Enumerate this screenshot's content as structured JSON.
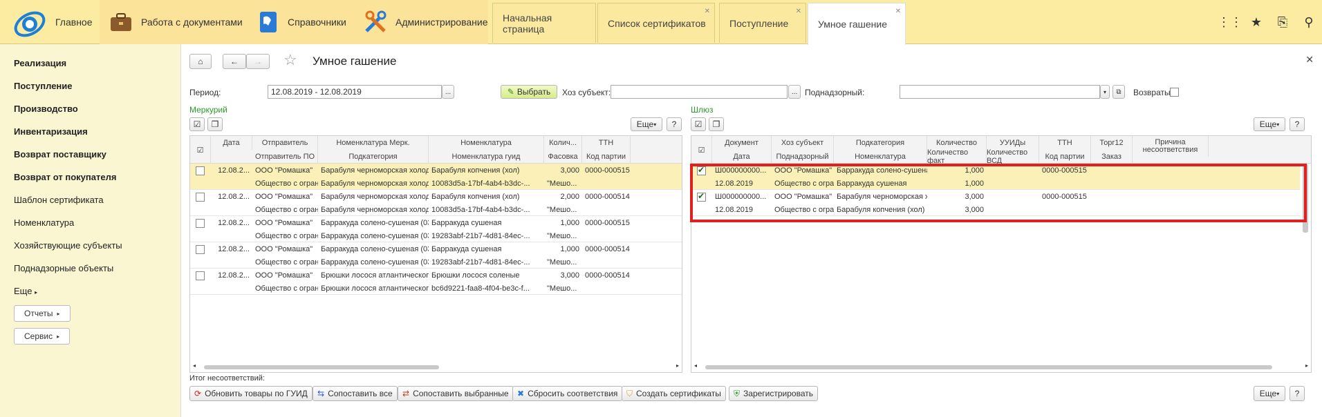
{
  "topbar": {
    "home_label": "Главное",
    "sections": [
      "Работа с документами",
      "Справочники",
      "Администрирование"
    ],
    "tabs": [
      {
        "label": "Начальная страница"
      },
      {
        "label": "Список сертификатов"
      },
      {
        "label": "Поступление"
      },
      {
        "label": "Умное гашение"
      }
    ]
  },
  "nav": {
    "bold_items": [
      "Реализация",
      "Поступление",
      "Производство",
      "Инвентаризация",
      "Возврат поставщику",
      "Возврат от покупателя"
    ],
    "items": [
      "Шаблон сертификата",
      "Номенклатура",
      "Хозяйствующие субъекты",
      "Поднадзорные объекты"
    ],
    "more": "Еще",
    "reports": "Отчеты",
    "service": "Сервис"
  },
  "form": {
    "title": "Умное гашение",
    "period_label": "Период:",
    "period_value": "12.08.2019 - 12.08.2019",
    "choose_button": "Выбрать",
    "hoz_label": "Хоз субъект:",
    "podnadz_label": "Поднадзорный:",
    "returns_label": "Возвраты:",
    "more_button": "Еще",
    "help_button": "?",
    "mismatch_label": "Итог несоответствий:"
  },
  "mercury": {
    "title": "Меркурий",
    "headers_top": [
      "Дата",
      "Отправитель",
      "Номенклатура Мерк.",
      "Номенклатура",
      "Колич...",
      "ТТН"
    ],
    "headers_bottom": [
      "Отправитель ПО",
      "Подкатегория",
      "Номенклатура гуид",
      "Фасовка",
      "Код партии"
    ],
    "rows": [
      {
        "date": "12.08.2...",
        "sender": "ООО \"Ромашка\"",
        "nom_merc": "Барабуля черноморская холодног...",
        "nom": "Барабуля копчения (хол)",
        "qty": "3,000",
        "ttn": "0000-000515",
        "sender_po": "Общество с огран...",
        "subcat": "Барабуля черноморская холодног...",
        "guid": "10083d5a-17bf-4ab4-b3dc-...",
        "pack": "\"Мешо..."
      },
      {
        "date": "12.08.2...",
        "sender": "ООО \"Ромашка\"",
        "nom_merc": "Барабуля черноморская холодног...",
        "nom": "Барабуля копчения (хол)",
        "qty": "2,000",
        "ttn": "0000-000514",
        "sender_po": "Общество с огран...",
        "subcat": "Барабуля черноморская холодног...",
        "guid": "10083d5a-17bf-4ab4-b3dc-...",
        "pack": "\"Мешо..."
      },
      {
        "date": "12.08.2...",
        "sender": "ООО \"Ромашка\"",
        "nom_merc": "Барракуда солено-сушеная (0305)",
        "nom": "Барракуда сушеная",
        "qty": "1,000",
        "ttn": "0000-000515",
        "sender_po": "Общество с огран...",
        "subcat": "Барракуда солено-сушеная (0305)",
        "guid": "19283abf-21b7-4d81-84ec-...",
        "pack": "\"Мешо..."
      },
      {
        "date": "12.08.2...",
        "sender": "ООО \"Ромашка\"",
        "nom_merc": "Барракуда солено-сушеная (0305)",
        "nom": "Барракуда сушеная",
        "qty": "1,000",
        "ttn": "0000-000514",
        "sender_po": "Общество с огран...",
        "subcat": "Барракуда солено-сушеная (0305)",
        "guid": "19283abf-21b7-4d81-84ec-...",
        "pack": "\"Мешо..."
      },
      {
        "date": "12.08.2...",
        "sender": "ООО \"Ромашка\"",
        "nom_merc": "Брюшки лосося атлантического с...",
        "nom": "Брюшки лосося соленые",
        "qty": "3,000",
        "ttn": "0000-000514",
        "sender_po": "Общество с огран...",
        "subcat": "Брюшки лосося атлантического с...",
        "guid": "bc6d9221-faa8-4f04-be3c-f...",
        "pack": "\"Мешо..."
      }
    ]
  },
  "gateway": {
    "title": "Шлюз",
    "headers_top": [
      "Документ",
      "Хоз субъект",
      "Подкатегория",
      "Количество",
      "УУИДы",
      "ТТН",
      "Торг12",
      "Причина несоответствия"
    ],
    "headers_bottom": [
      "Дата",
      "Поднадзорный",
      "Номенклатура",
      "Количество факт",
      "Количество ВСД",
      "Код партии",
      "Заказ"
    ],
    "rows": [
      {
        "doc": "Ш000000000...",
        "hoz": "ООО \"Ромашка\"",
        "subcat": "Барракуда солено-сушеная (...",
        "qty": "1,000",
        "ttn": "0000-000515",
        "date": "12.08.2019",
        "podnadz": "Общество с огран...",
        "nom": "Барракуда сушеная",
        "qty_fact": "1,000"
      },
      {
        "doc": "Ш000000000...",
        "hoz": "ООО \"Ромашка\"",
        "subcat": "Барабуля черноморская хол...",
        "qty": "3,000",
        "ttn": "0000-000515",
        "date": "12.08.2019",
        "podnadz": "Общество с огран...",
        "nom": "Барабуля копчения (хол)",
        "qty_fact": "3,000"
      }
    ]
  },
  "bottom_buttons": [
    "Обновить товары по ГУИД",
    "Сопоставить все",
    "Сопоставить выбранные",
    "Сбросить соответствия",
    "Создать сертификаты",
    "Зарегистрировать"
  ],
  "colors": {
    "accent_green": "#2a9a2a",
    "highlight_red": "#e02020",
    "row_highlight": "#fbf0b8"
  }
}
